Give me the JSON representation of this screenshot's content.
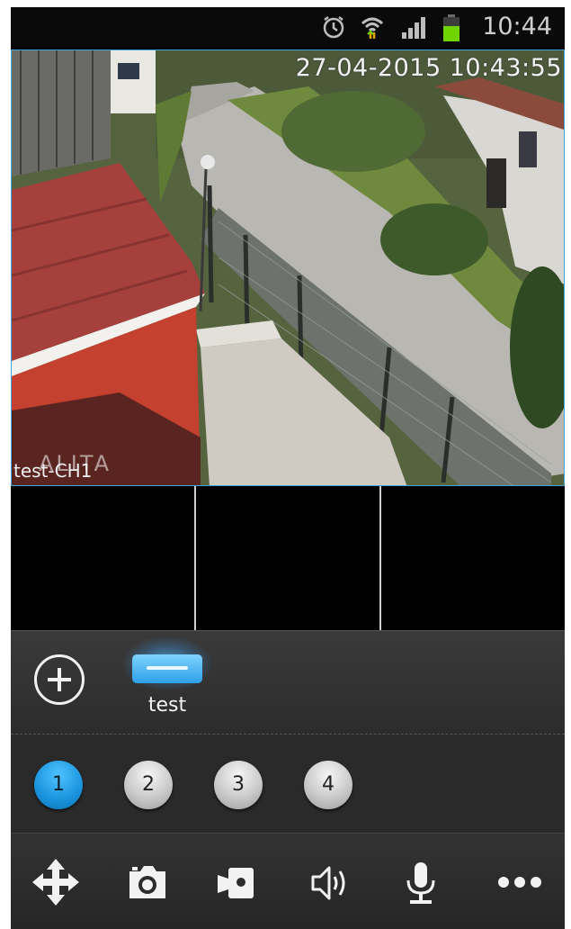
{
  "status_bar": {
    "time": "10:44",
    "icons": [
      "alarm-clock-icon",
      "wifi-icon",
      "signal-icon",
      "battery-icon"
    ],
    "battery_color": "#6fd400"
  },
  "video": {
    "osd_timestamp": "27-04-2015 10:43:55",
    "osd_brand": "ALITA",
    "osd_channel": "test-CH1",
    "selected_border_color": "#3aa7e0"
  },
  "device_bar": {
    "add_icon": "plus-circle-icon",
    "device_label": "test",
    "device_color": "#3aa7e0"
  },
  "channels": {
    "items": [
      "1",
      "2",
      "3",
      "4"
    ],
    "active": "1",
    "active_color": "#1a93dd"
  },
  "toolbar": {
    "icons": [
      "move-arrows-icon",
      "camera-icon",
      "video-record-icon",
      "speaker-icon",
      "microphone-icon",
      "more-icon"
    ]
  }
}
